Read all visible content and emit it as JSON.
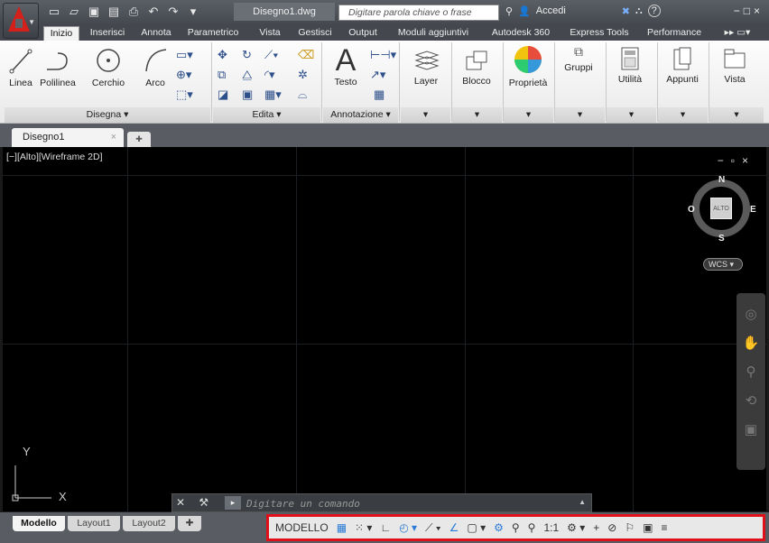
{
  "titlebar": {
    "doc_title": "Disegno1.dwg",
    "search_placeholder": "Digitare parola chiave o frase",
    "signin": "Accedi",
    "help": "?"
  },
  "ribbon_tabs": [
    "Inizio",
    "Inserisci",
    "Annota",
    "Parametrico",
    "Vista",
    "Gestisci",
    "Output",
    "Moduli aggiuntivi",
    "Autodesk 360",
    "Express Tools",
    "Performance"
  ],
  "panels": {
    "draw": {
      "label": "Disegna ▾",
      "tools": [
        "Linea",
        "Polilinea",
        "Cerchio",
        "Arco"
      ]
    },
    "modify": {
      "label": "Edita ▾"
    },
    "annotation": {
      "label": "Annotazione ▾",
      "text_tool": "Testo"
    },
    "large_tools": [
      "Layer",
      "Blocco",
      "Proprietà",
      "Gruppi",
      "Utilità",
      "Appunti",
      "Vista"
    ]
  },
  "file_tab": {
    "name": "Disegno1",
    "close": "×"
  },
  "viewport": {
    "label": "[−][Alto][Wireframe 2D]",
    "viewcube": {
      "face": "ALTO",
      "n": "N",
      "s": "S",
      "e": "E",
      "w": "O",
      "wcs": "WCS"
    },
    "ucs": {
      "x": "X",
      "y": "Y"
    }
  },
  "command_line": {
    "placeholder": "Digitare un comando"
  },
  "layout_tabs": [
    "Modello",
    "Layout1",
    "Layout2"
  ],
  "status": {
    "model": "MODELLO",
    "scale": "1:1"
  },
  "colors": {
    "highlight": "#e0101a",
    "accent": "#2a7ad6",
    "logo": "#d4201b"
  }
}
